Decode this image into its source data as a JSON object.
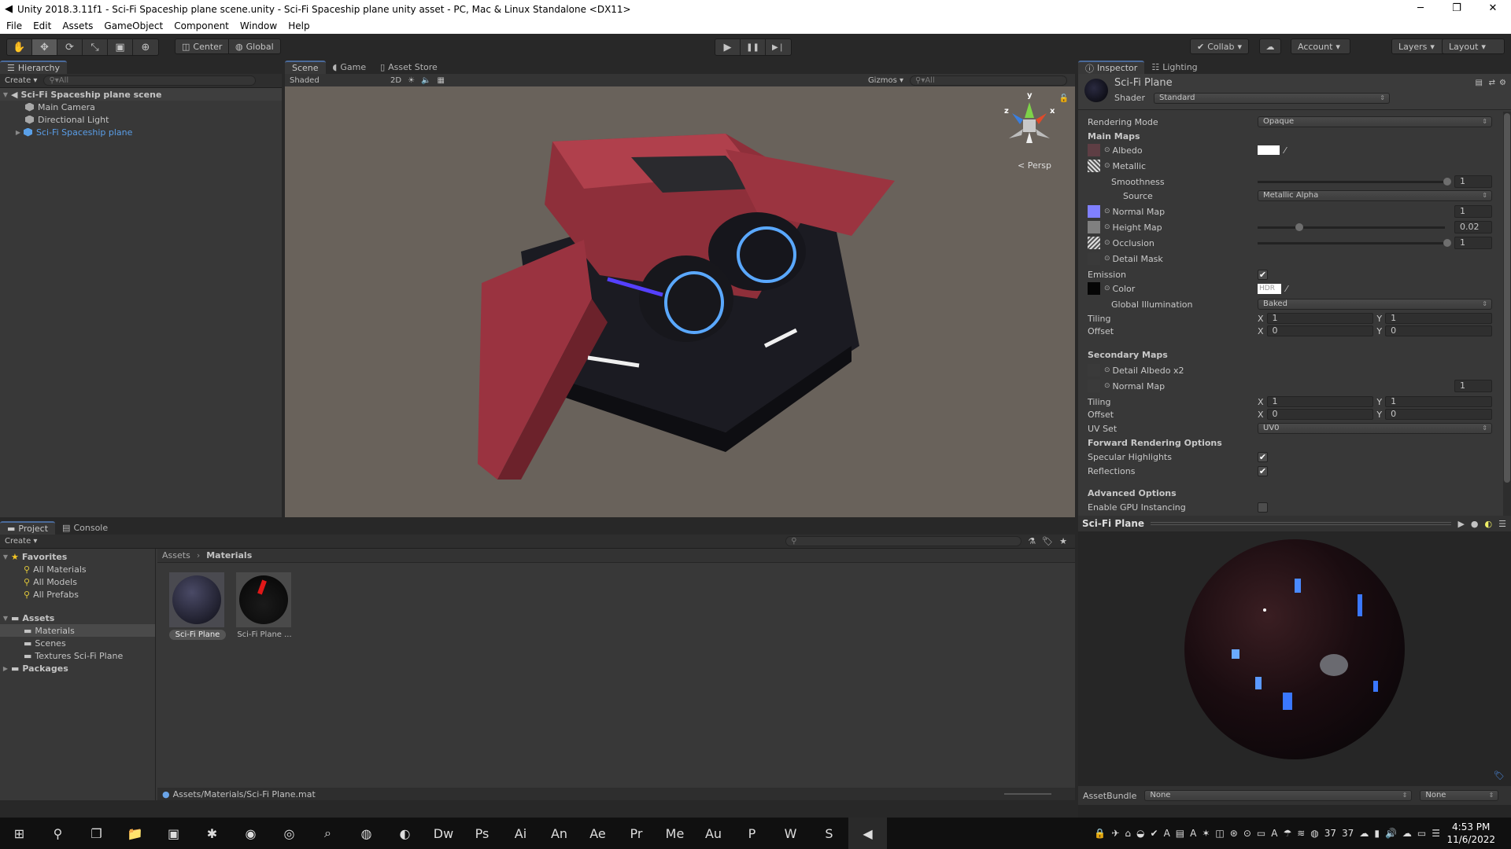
{
  "window": {
    "title": "Unity 2018.3.11f1 - Sci-Fi Spaceship plane scene.unity - Sci-Fi Spaceship plane unity asset - PC, Mac & Linux Standalone <DX11>",
    "controls": {
      "minimize": "─",
      "restore": "❐",
      "close": "✕"
    }
  },
  "menu": [
    "File",
    "Edit",
    "Assets",
    "GameObject",
    "Component",
    "Window",
    "Help"
  ],
  "toolbar": {
    "transform_tools": [
      "hand-tool",
      "move-tool",
      "rotate-tool",
      "scale-tool",
      "rect-tool",
      "transform-tool"
    ],
    "transform_glyphs": [
      "✋",
      "✥",
      "⟳",
      "⤡",
      "▣",
      "⊕"
    ],
    "pivot": "Center",
    "space": "Global",
    "play_glyphs": [
      "▶",
      "❚❚",
      "▶❘"
    ],
    "collab": "Collab",
    "account": "Account",
    "layers": "Layers",
    "layout": "Layout"
  },
  "hierarchy": {
    "tab": "Hierarchy",
    "create": "Create",
    "search_placeholder": "All",
    "scene": "Sci-Fi Spaceship plane scene",
    "items": [
      {
        "label": "Main Camera",
        "color": "#c4c4c4"
      },
      {
        "label": "Directional Light",
        "color": "#c4c4c4"
      },
      {
        "label": "Sci-Fi Spaceship plane",
        "color": "#5a9ee8"
      }
    ]
  },
  "scene_view": {
    "tabs": [
      "Scene",
      "Game",
      "Asset Store"
    ],
    "shading": "Shaded",
    "mode_2d": "2D",
    "gizmos": "Gizmos",
    "search_placeholder": "All",
    "projection": "Persp",
    "axes": {
      "x": "x",
      "y": "y",
      "z": "z"
    }
  },
  "inspector": {
    "tabs": [
      "Inspector",
      "Lighting"
    ],
    "material_name": "Sci-Fi Plane",
    "shader_label": "Shader",
    "shader": "Standard",
    "rendering_mode_label": "Rendering Mode",
    "rendering_mode": "Opaque",
    "main_maps": "Main Maps",
    "albedo": "Albedo",
    "metallic": "Metallic",
    "smoothness": "Smoothness",
    "smoothness_value": "1",
    "source": "Source",
    "source_value": "Metallic Alpha",
    "normal_map": "Normal Map",
    "normal_value": "1",
    "height_map": "Height Map",
    "height_value": "0.02",
    "height_fraction": 0.2,
    "occlusion": "Occlusion",
    "occlusion_value": "1",
    "detail_mask": "Detail Mask",
    "emission": "Emission",
    "emission_checked": true,
    "color": "Color",
    "hdr": "HDR",
    "gi": "Global Illumination",
    "gi_value": "Baked",
    "tiling": "Tiling",
    "offset": "Offset",
    "x": "X",
    "y": "Y",
    "tiling_x": "1",
    "tiling_y": "1",
    "offset_x": "0",
    "offset_y": "0",
    "secondary_maps": "Secondary Maps",
    "detail_albedo": "Detail Albedo x2",
    "sec_normal_map": "Normal Map",
    "sec_normal_value": "1",
    "sec_tiling_x": "1",
    "sec_tiling_y": "1",
    "sec_offset_x": "0",
    "sec_offset_y": "0",
    "uv_set": "UV Set",
    "uv_value": "UV0",
    "forward": "Forward Rendering Options",
    "specular": "Specular Highlights",
    "reflections": "Reflections",
    "advanced": "Advanced Options",
    "gpu_instancing": "Enable GPU Instancing",
    "colors": {
      "normal_thumb": "#8080ff",
      "height_thumb": "#808080",
      "albedo_thumb": "#5e3e44"
    }
  },
  "preview": {
    "title": "Sci-Fi Plane",
    "asset_bundle_label": "AssetBundle",
    "asset_bundle": "None",
    "asset_variant": "None"
  },
  "project": {
    "tabs": [
      "Project",
      "Console"
    ],
    "create": "Create",
    "favorites": "Favorites",
    "favorite_items": [
      "All Materials",
      "All Models",
      "All Prefabs"
    ],
    "assets": "Assets",
    "asset_folders": [
      "Materials",
      "Scenes",
      "Textures Sci-Fi Plane"
    ],
    "packages": "Packages",
    "breadcrumb": [
      "Assets",
      "Materials"
    ],
    "files": [
      "Sci-Fi Plane",
      "Sci-Fi Plane ..."
    ],
    "status_path": "Assets/Materials/Sci-Fi Plane.mat"
  },
  "taskbar": {
    "apps": [
      "windows-start",
      "search",
      "task-view",
      "file-explorer",
      "store",
      "app-a",
      "firefox",
      "chrome",
      "search-app",
      "globe",
      "earth",
      "dreamweaver",
      "photoshop",
      "illustrator",
      "animate",
      "after-effects",
      "premiere",
      "media-encoder",
      "audition",
      "powerpoint",
      "word",
      "sublime",
      "unity"
    ],
    "glyphs": [
      "⊞",
      "⚲",
      "❐",
      "📁",
      "▣",
      "✱",
      "◉",
      "◎",
      "⌕",
      "◍",
      "◐",
      "Dw",
      "Ps",
      "Ai",
      "An",
      "Ae",
      "Pr",
      "Me",
      "Au",
      "P",
      "W",
      "S",
      "◀"
    ],
    "tray_glyphs": [
      "🔒",
      "✈",
      "⌂",
      "◒",
      "✔",
      "A",
      "▤",
      "A",
      "✶",
      "◫",
      "⊛",
      "⊙",
      "▭",
      "A",
      "☂",
      "≋",
      "◍",
      "37",
      "37",
      "☁",
      "▮",
      "🔊",
      "☁",
      "▭",
      "☰"
    ],
    "time": "4:53 PM",
    "date": "11/6/2022"
  }
}
